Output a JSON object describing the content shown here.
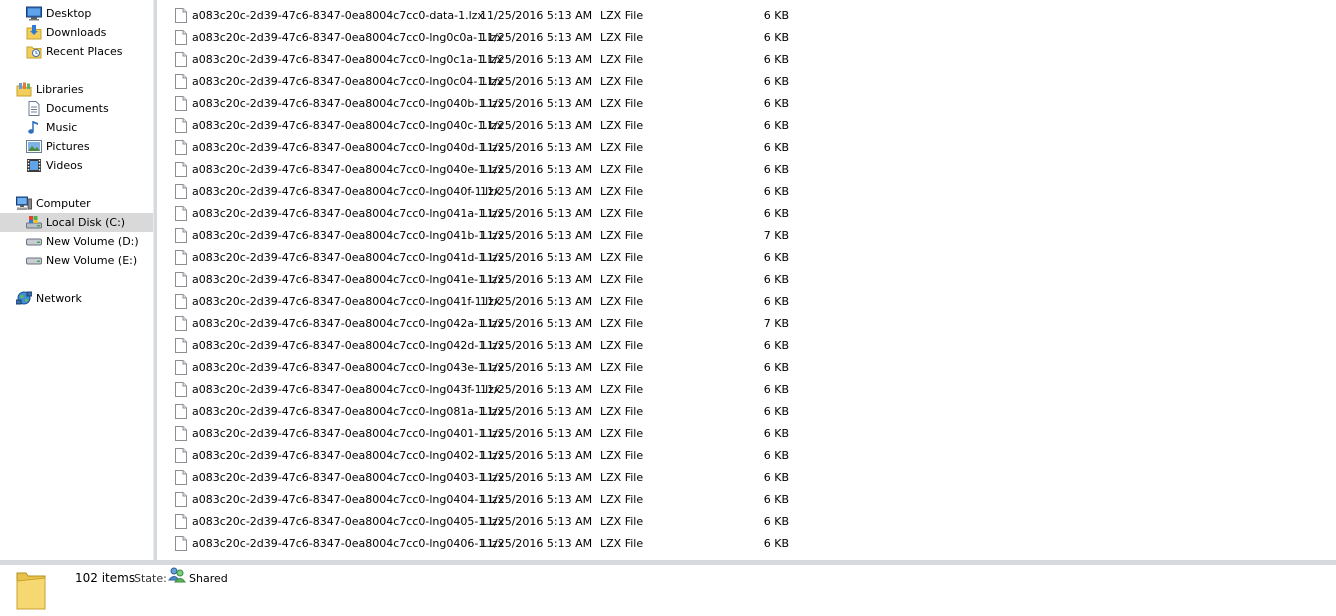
{
  "nav": {
    "favorites": [
      "Desktop",
      "Downloads",
      "Recent Places"
    ],
    "libraries_label": "Libraries",
    "libraries": [
      "Documents",
      "Music",
      "Pictures",
      "Videos"
    ],
    "computer_label": "Computer",
    "drives": [
      "Local Disk (C:)",
      "New Volume (D:)",
      "New Volume (E:)"
    ],
    "selected_drive": "Local Disk (C:)",
    "network_label": "Network"
  },
  "files": [
    {
      "name": "a083c20c-2d39-47c6-8347-0ea8004c7cc0-data-1.lzx",
      "date": "11/25/2016 5:13 AM",
      "type": "LZX File",
      "size": "6 KB"
    },
    {
      "name": "a083c20c-2d39-47c6-8347-0ea8004c7cc0-lng0c0a-1.lzx",
      "date": "11/25/2016 5:13 AM",
      "type": "LZX File",
      "size": "6 KB"
    },
    {
      "name": "a083c20c-2d39-47c6-8347-0ea8004c7cc0-lng0c1a-1.lzx",
      "date": "11/25/2016 5:13 AM",
      "type": "LZX File",
      "size": "6 KB"
    },
    {
      "name": "a083c20c-2d39-47c6-8347-0ea8004c7cc0-lng0c04-1.lzx",
      "date": "11/25/2016 5:13 AM",
      "type": "LZX File",
      "size": "6 KB"
    },
    {
      "name": "a083c20c-2d39-47c6-8347-0ea8004c7cc0-lng040b-1.lzx",
      "date": "11/25/2016 5:13 AM",
      "type": "LZX File",
      "size": "6 KB"
    },
    {
      "name": "a083c20c-2d39-47c6-8347-0ea8004c7cc0-lng040c-1.lzx",
      "date": "11/25/2016 5:13 AM",
      "type": "LZX File",
      "size": "6 KB"
    },
    {
      "name": "a083c20c-2d39-47c6-8347-0ea8004c7cc0-lng040d-1.lzx",
      "date": "11/25/2016 5:13 AM",
      "type": "LZX File",
      "size": "6 KB"
    },
    {
      "name": "a083c20c-2d39-47c6-8347-0ea8004c7cc0-lng040e-1.lzx",
      "date": "11/25/2016 5:13 AM",
      "type": "LZX File",
      "size": "6 KB"
    },
    {
      "name": "a083c20c-2d39-47c6-8347-0ea8004c7cc0-lng040f-1.lzx",
      "date": "11/25/2016 5:13 AM",
      "type": "LZX File",
      "size": "6 KB"
    },
    {
      "name": "a083c20c-2d39-47c6-8347-0ea8004c7cc0-lng041a-1.lzx",
      "date": "11/25/2016 5:13 AM",
      "type": "LZX File",
      "size": "6 KB"
    },
    {
      "name": "a083c20c-2d39-47c6-8347-0ea8004c7cc0-lng041b-1.lzx",
      "date": "11/25/2016 5:13 AM",
      "type": "LZX File",
      "size": "7 KB"
    },
    {
      "name": "a083c20c-2d39-47c6-8347-0ea8004c7cc0-lng041d-1.lzx",
      "date": "11/25/2016 5:13 AM",
      "type": "LZX File",
      "size": "6 KB"
    },
    {
      "name": "a083c20c-2d39-47c6-8347-0ea8004c7cc0-lng041e-1.lzx",
      "date": "11/25/2016 5:13 AM",
      "type": "LZX File",
      "size": "6 KB"
    },
    {
      "name": "a083c20c-2d39-47c6-8347-0ea8004c7cc0-lng041f-1.lzx",
      "date": "11/25/2016 5:13 AM",
      "type": "LZX File",
      "size": "6 KB"
    },
    {
      "name": "a083c20c-2d39-47c6-8347-0ea8004c7cc0-lng042a-1.lzx",
      "date": "11/25/2016 5:13 AM",
      "type": "LZX File",
      "size": "7 KB"
    },
    {
      "name": "a083c20c-2d39-47c6-8347-0ea8004c7cc0-lng042d-1.lzx",
      "date": "11/25/2016 5:13 AM",
      "type": "LZX File",
      "size": "6 KB"
    },
    {
      "name": "a083c20c-2d39-47c6-8347-0ea8004c7cc0-lng043e-1.lzx",
      "date": "11/25/2016 5:13 AM",
      "type": "LZX File",
      "size": "6 KB"
    },
    {
      "name": "a083c20c-2d39-47c6-8347-0ea8004c7cc0-lng043f-1.lzx",
      "date": "11/25/2016 5:13 AM",
      "type": "LZX File",
      "size": "6 KB"
    },
    {
      "name": "a083c20c-2d39-47c6-8347-0ea8004c7cc0-lng081a-1.lzx",
      "date": "11/25/2016 5:13 AM",
      "type": "LZX File",
      "size": "6 KB"
    },
    {
      "name": "a083c20c-2d39-47c6-8347-0ea8004c7cc0-lng0401-1.lzx",
      "date": "11/25/2016 5:13 AM",
      "type": "LZX File",
      "size": "6 KB"
    },
    {
      "name": "a083c20c-2d39-47c6-8347-0ea8004c7cc0-lng0402-1.lzx",
      "date": "11/25/2016 5:13 AM",
      "type": "LZX File",
      "size": "6 KB"
    },
    {
      "name": "a083c20c-2d39-47c6-8347-0ea8004c7cc0-lng0403-1.lzx",
      "date": "11/25/2016 5:13 AM",
      "type": "LZX File",
      "size": "6 KB"
    },
    {
      "name": "a083c20c-2d39-47c6-8347-0ea8004c7cc0-lng0404-1.lzx",
      "date": "11/25/2016 5:13 AM",
      "type": "LZX File",
      "size": "6 KB"
    },
    {
      "name": "a083c20c-2d39-47c6-8347-0ea8004c7cc0-lng0405-1.lzx",
      "date": "11/25/2016 5:13 AM",
      "type": "LZX File",
      "size": "6 KB"
    },
    {
      "name": "a083c20c-2d39-47c6-8347-0ea8004c7cc0-lng0406-1.lzx",
      "date": "11/25/2016 5:13 AM",
      "type": "LZX File",
      "size": "6 KB"
    }
  ],
  "details": {
    "item_count": "102 items",
    "state_label": "State:",
    "state_value": "Shared"
  },
  "colors": {
    "selection": "#d9d9d9",
    "pane_border": "#d6d9de",
    "folder_yellow": "#f2cf5b"
  },
  "icons": {
    "folder": "folder-icon",
    "file": "file-icon",
    "shared": "shared-users-icon"
  }
}
